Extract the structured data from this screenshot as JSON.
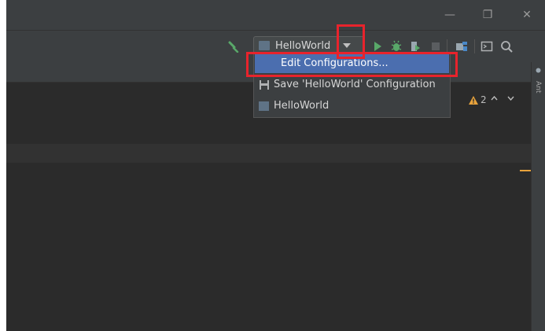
{
  "window": {
    "minimize_glyph": "—",
    "restore_glyph": "❐",
    "close_glyph": "✕"
  },
  "toolbar": {
    "run_config": "HelloWorld",
    "icons": [
      "hammer-icon",
      "run-config-icon",
      "chevron-down-icon",
      "run-icon",
      "debug-icon",
      "coverage-icon",
      "stop-icon",
      "project-structure-icon",
      "terminal-icon",
      "search-icon"
    ]
  },
  "popup": {
    "items": [
      {
        "label": "Edit Configurations...",
        "selected": true
      },
      {
        "label": "Save 'HelloWorld' Configuration",
        "icon": "save-icon"
      },
      {
        "label": "HelloWorld",
        "icon": "run-config-icon"
      }
    ]
  },
  "editor": {
    "warning_count": "2",
    "prev_glyph": "^",
    "next_glyph": "v"
  },
  "right_strip": {
    "label": "Ant"
  },
  "colors": {
    "bg": "#2b2b2b",
    "chrome": "#3c3f41",
    "selection": "#4b6eaf",
    "annotation": "#e8232c",
    "run_green": "#59a869",
    "warning": "#e8a33c"
  }
}
